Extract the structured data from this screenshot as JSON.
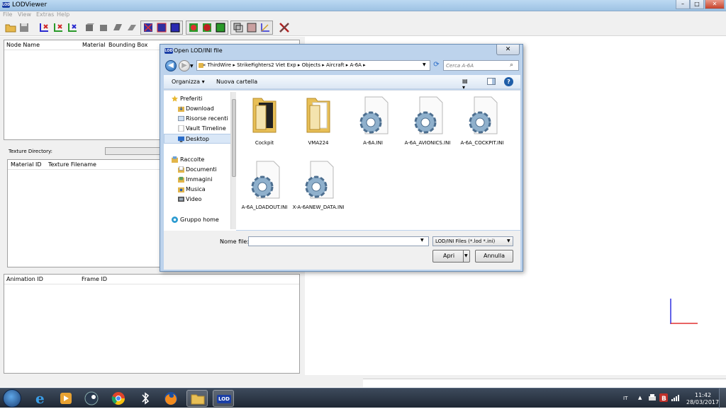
{
  "app": {
    "logo": "LOD",
    "title": "LODViewer",
    "window_buttons": {
      "minimize": "–",
      "maximize": "□",
      "close": "✕"
    },
    "menu": [
      "File",
      "View",
      "Extras",
      "Help"
    ]
  },
  "node_panel": {
    "columns": [
      "Node Name",
      "Material",
      "Bounding Box"
    ]
  },
  "texture": {
    "directory_label": "Texture Directory:",
    "columns": [
      "Material ID",
      "Texture Filename"
    ]
  },
  "animation_panel": {
    "columns": [
      "Animation ID",
      "Frame ID"
    ]
  },
  "dialog": {
    "icon_label": "LOD",
    "title": "Open LOD/INI file",
    "close_label": "✕",
    "address_path": "«  ThirdWire  ▸  StrikeFighters2 Viet Exp  ▸  Objects  ▸  Aircraft  ▸  A-6A  ▸",
    "search_placeholder": "Cerca A-6A",
    "organize_label": "Organizza ▾",
    "new_folder_label": "Nuova cartella",
    "help_label": "?",
    "nav": [
      {
        "label": "Preferiti",
        "icon": "star-icon"
      },
      {
        "label": "Download",
        "icon": "download-folder-icon"
      },
      {
        "label": "Risorse recenti",
        "icon": "recent-places-icon"
      },
      {
        "label": "Vault Timeline",
        "icon": "document-icon"
      },
      {
        "label": "Desktop",
        "icon": "desktop-icon",
        "selected": true
      },
      {
        "label": "Raccolte",
        "icon": "library-icon"
      },
      {
        "label": "Documenti",
        "icon": "documents-icon"
      },
      {
        "label": "Immagini",
        "icon": "pictures-icon"
      },
      {
        "label": "Musica",
        "icon": "music-icon"
      },
      {
        "label": "Video",
        "icon": "video-icon"
      },
      {
        "label": "Gruppo home",
        "icon": "homegroup-icon"
      }
    ],
    "files": [
      {
        "name": "Cockpit",
        "type": "folder"
      },
      {
        "name": "VMA224",
        "type": "folder"
      },
      {
        "name": "A-6A.INI",
        "type": "ini"
      },
      {
        "name": "A-6A_AVIONICS.INI",
        "type": "ini"
      },
      {
        "name": "A-6A_COCKPIT.INI",
        "type": "ini"
      },
      {
        "name": "A-6A_LOADOUT.INI",
        "type": "ini"
      },
      {
        "name": "X-A-6ANEW_DATA.INI",
        "type": "ini"
      }
    ],
    "filename_label": "Nome file:",
    "filename_value": "",
    "filter": "LOD/INI Files (*.lod *.ini)",
    "open_label": "Apri",
    "cancel_label": "Annulla"
  },
  "taskbar": {
    "apps": [
      "internet-explorer",
      "media-player",
      "steam",
      "chrome",
      "bluetooth",
      "firefox",
      "file-explorer",
      "lodviewer"
    ],
    "lodviewer_label": "LOD",
    "lang": "IT",
    "tray_arrow": "▲",
    "time": "11:42",
    "date": "28/03/2017"
  },
  "colors": {
    "accent": "#1b3fa6",
    "dialog_frame": "#bdd3ec",
    "folder": "#e2b54a",
    "axis_red": "#e03030",
    "axis_blue": "#3030e0"
  }
}
